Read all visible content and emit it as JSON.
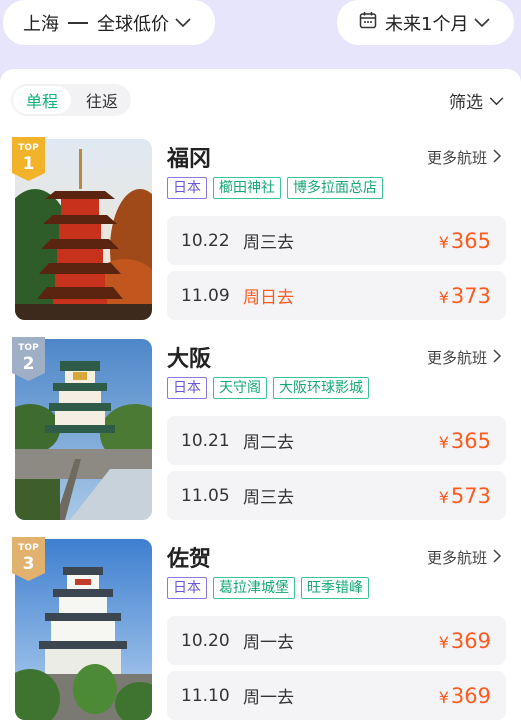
{
  "header": {
    "route_from": "上海",
    "route_to": "全球低价",
    "date_range": "未来1个月"
  },
  "toolbar": {
    "segments": [
      "单程",
      "往返"
    ],
    "filter_label": "筛选"
  },
  "more_flights_label": "更多航班",
  "currency": "¥",
  "cards": [
    {
      "rank": "1",
      "rank_label": "TOP",
      "city": "福冈",
      "tags": [
        "日本",
        "櫛田神社",
        "博多拉面总店"
      ],
      "flights": [
        {
          "date": "10.22",
          "weekday": "周三去",
          "price": "365",
          "highlight": false
        },
        {
          "date": "11.09",
          "weekday": "周日去",
          "price": "373",
          "highlight": true
        }
      ]
    },
    {
      "rank": "2",
      "rank_label": "TOP",
      "city": "大阪",
      "tags": [
        "日本",
        "天守阁",
        "大阪环球影城"
      ],
      "flights": [
        {
          "date": "10.21",
          "weekday": "周二去",
          "price": "365",
          "highlight": false
        },
        {
          "date": "11.05",
          "weekday": "周三去",
          "price": "573",
          "highlight": false
        }
      ]
    },
    {
      "rank": "3",
      "rank_label": "TOP",
      "city": "佐贺",
      "tags": [
        "日本",
        "葛拉津城堡",
        "旺季错峰"
      ],
      "flights": [
        {
          "date": "10.20",
          "weekday": "周一去",
          "price": "369",
          "highlight": false
        },
        {
          "date": "11.10",
          "weekday": "周一去",
          "price": "369",
          "highlight": false
        }
      ]
    }
  ],
  "colors": {
    "accent_green": "#10b37a",
    "price_orange": "#ff5a1f",
    "country_tag": "#6e53d9",
    "badge_gold": "#f0b32a",
    "badge_silver": "#9fb0c6",
    "badge_bronze": "#e0b26e"
  }
}
